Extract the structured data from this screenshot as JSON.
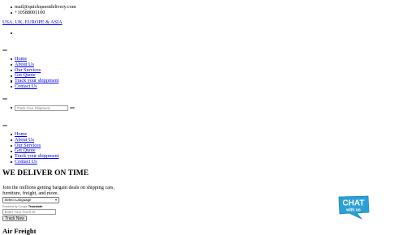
{
  "contact": {
    "email": "mail@quickquestdelivery.com",
    "phone": "+10588001100"
  },
  "region_link": "USA, UK, EUROPE & ASIA",
  "nav_primary": [
    "Home",
    "About Us",
    "Our Services",
    "Get Quote",
    "Track your shippment",
    "Contact Us"
  ],
  "search": {
    "placeholder": "Track Your Shipment"
  },
  "nav_secondary": [
    "Home",
    "About Us",
    "Our Services",
    "Get Quote",
    "Track your shippment",
    "Contact Us"
  ],
  "hero": {
    "headline": "WE DELIVER ON TIME",
    "subtext": "Join the millions getting bargain deals on shipping cars, furniture, freight, and more."
  },
  "translate": {
    "select_value": "Select Language",
    "powered_prefix": "Powered by",
    "google": "Google",
    "translate": "Translate"
  },
  "tracking": {
    "placeholder": "Enter Your Track ID",
    "button_label": "Track Now"
  },
  "section_title": "Air Freight",
  "chat_badge": {
    "line1": "CHAT",
    "line2": "with us",
    "color": "#2aa0d8"
  }
}
